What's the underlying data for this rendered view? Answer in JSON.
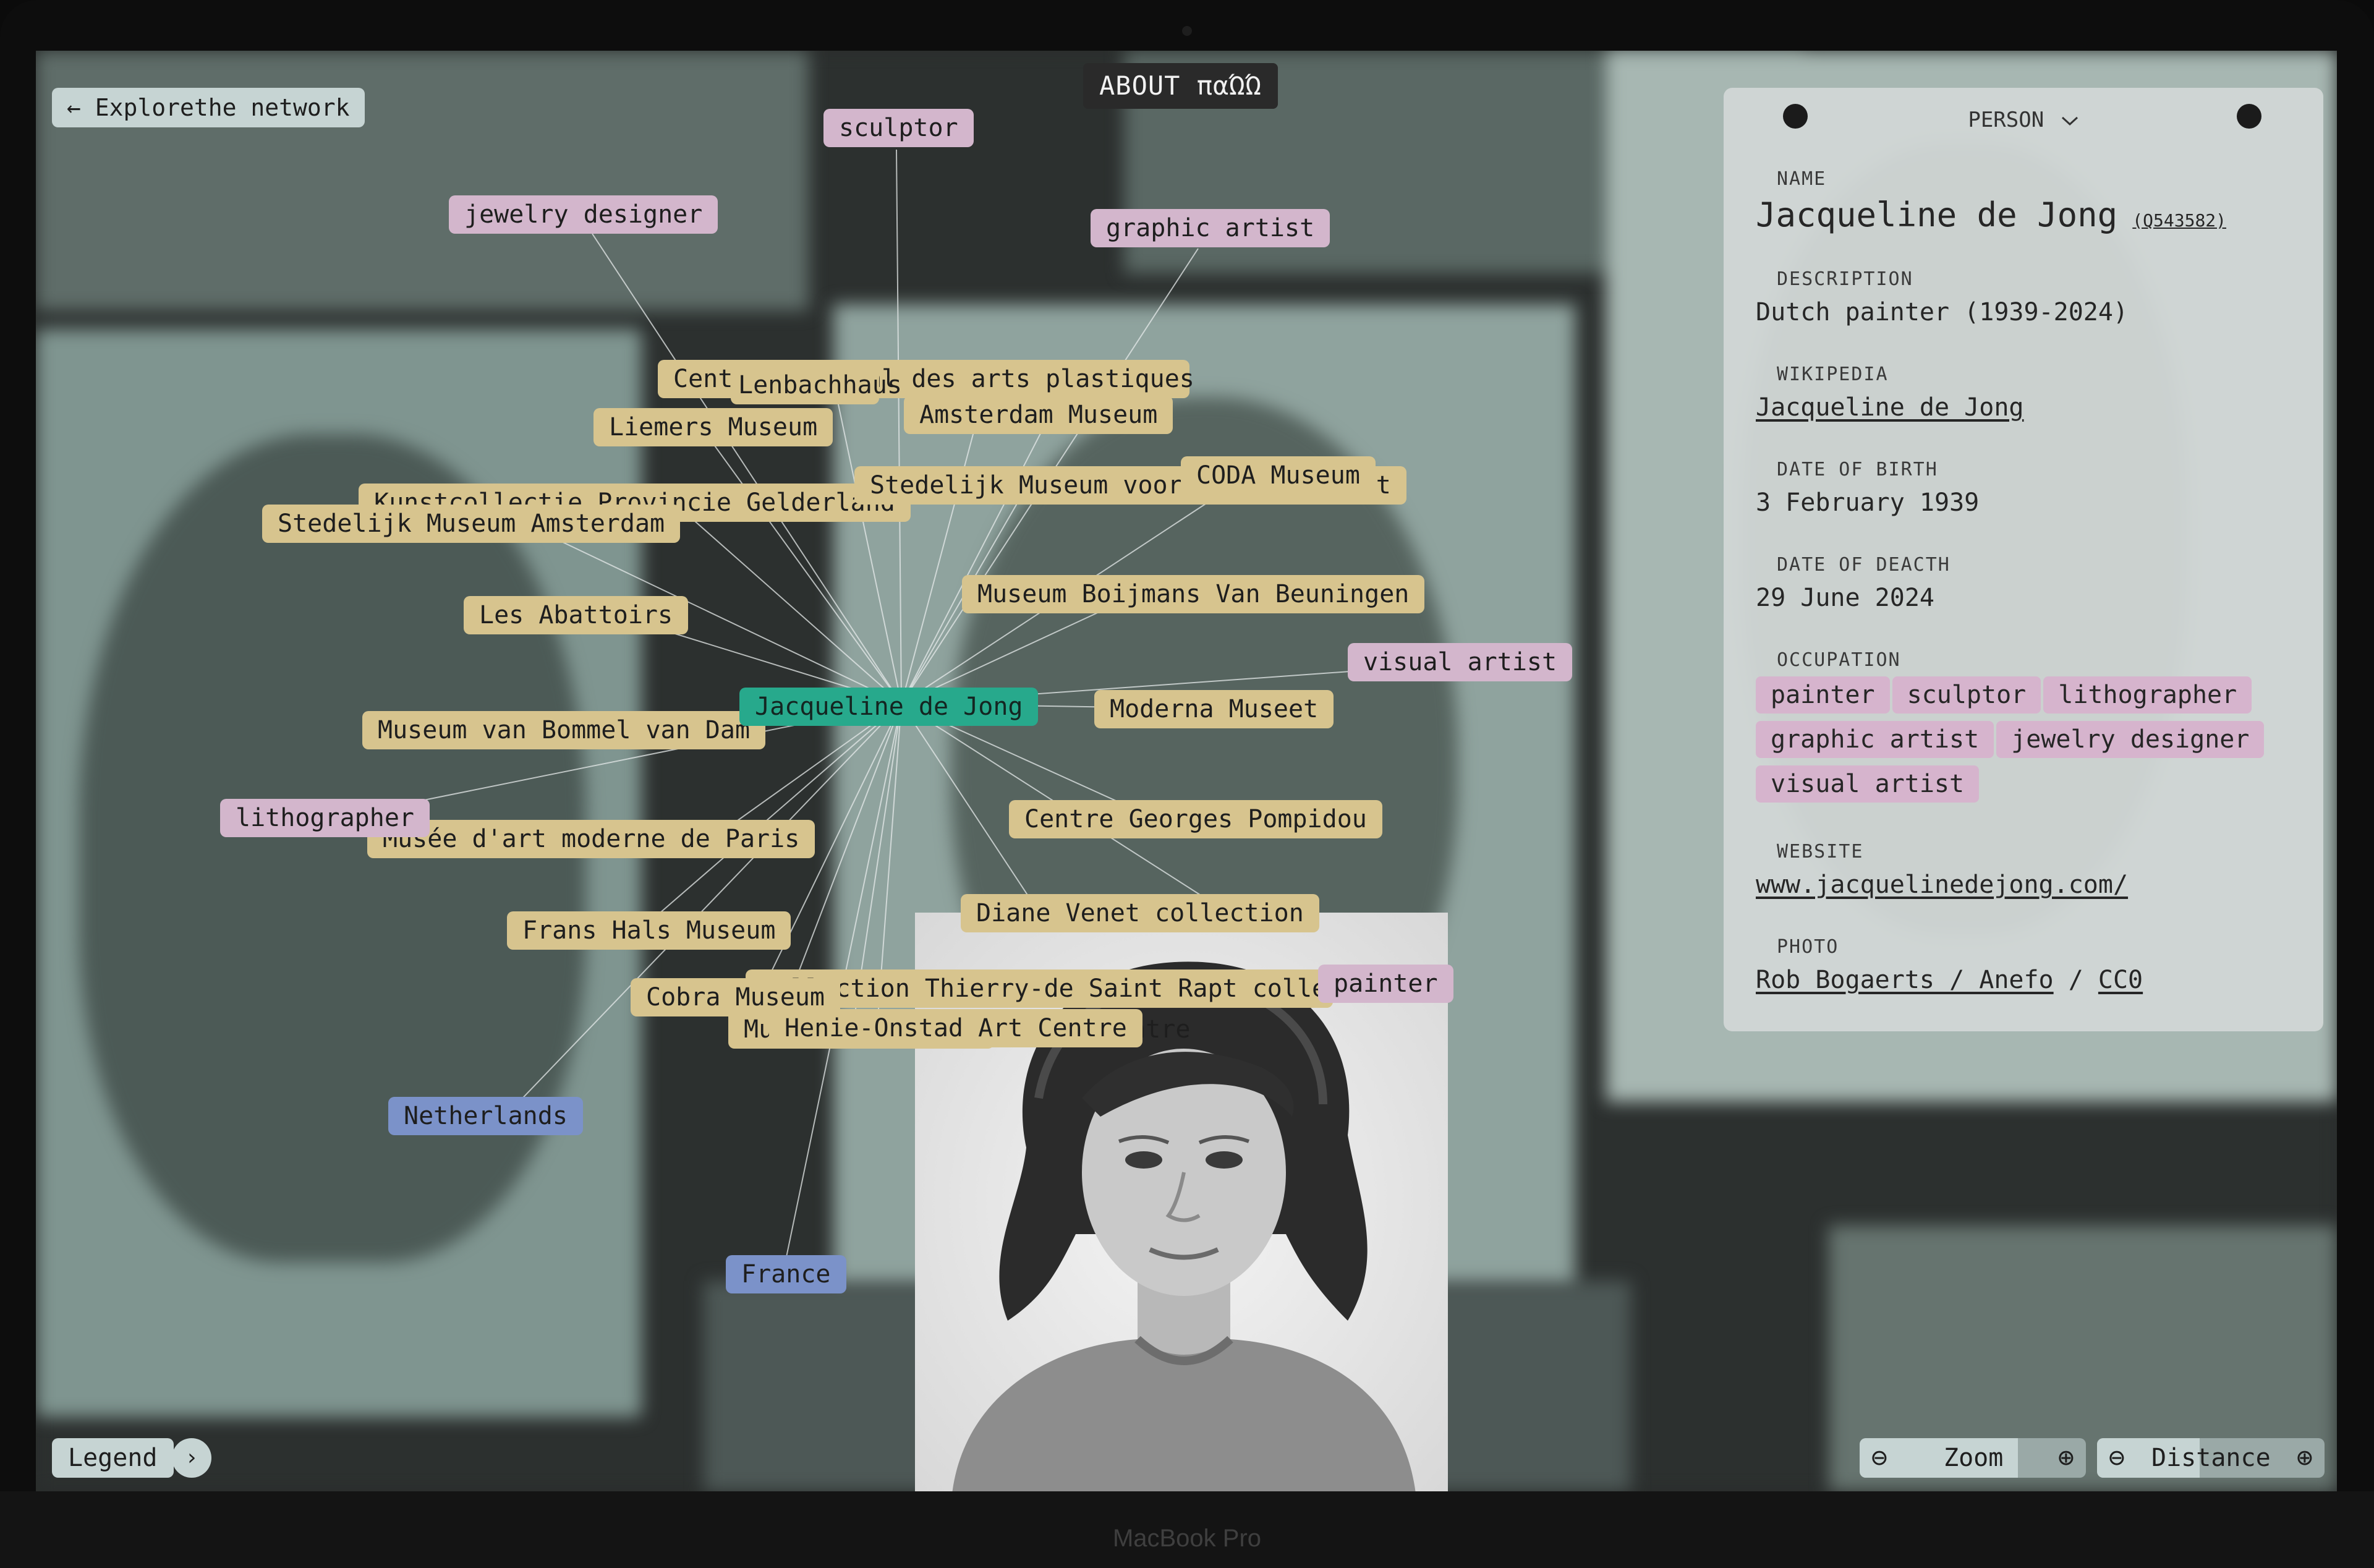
{
  "device": {
    "model_label": "MacBook Pro"
  },
  "header": {
    "back_label": "← Explorethe network",
    "about_label": "ABOUT παΏΏ"
  },
  "graph": {
    "center": "Jacqueline de Jong",
    "organizations": [
      "Centre national des arts plastiques",
      "Lenbachhaus",
      "Amsterdam Museum",
      "Liemers Museum",
      "Stedelijk Museum voor Actuele Kunst",
      "CODA Museum",
      "Kunstcollectie Provincie Gelderland",
      "Stedelijk Museum Amsterdam",
      "Museum Boijmans Van Beuningen",
      "Les Abattoirs",
      "Moderna Museet",
      "Museum van Bommel van Dam",
      "Musée d'art moderne de Paris",
      "Centre Georges Pompidou",
      "Diane Venet collection",
      "Frans Hals Museum",
      "Collection Thierry-de Saint Rapt collection",
      "Cobra Museum",
      "Museum Henie-Onstad Art Centre",
      "Henie-Onstad Art Centre"
    ],
    "occupations": [
      "sculptor",
      "jewelry designer",
      "graphic artist",
      "visual artist",
      "lithographer",
      "painter"
    ],
    "countries": [
      "Netherlands",
      "France"
    ]
  },
  "panel": {
    "type_label": "PERSON",
    "name_label": "NAME",
    "name_value": "Jacqueline de Jong",
    "qid": "(Q543582)",
    "description_label": "DESCRIPTION",
    "description_value": "Dutch painter (1939-2024)",
    "wikipedia_label": "WIKIPEDIA",
    "wikipedia_value": "Jacqueline de Jong",
    "dob_label": "DATE OF BIRTH",
    "dob_value": "3 February 1939",
    "dod_label": "DATE OF DEACTH",
    "dod_value": "29 June 2024",
    "occupation_label": "OCCUPATION",
    "occupations": [
      "painter",
      "sculptor",
      "lithographer",
      "graphic artist",
      "jewelry designer",
      "visual artist"
    ],
    "website_label": "WEBSITE",
    "website_value": "www.jacquelinedejong.com/",
    "photo_label": "PHOTO",
    "photo_author": "Rob Bogaerts / Anefo",
    "photo_sep": " / ",
    "photo_license": "CC0"
  },
  "controls": {
    "legend_label": "Legend",
    "legend_arrow": "›",
    "zoom_label": "Zoom",
    "zoom_level": 0.7,
    "distance_label": "Distance",
    "distance_level": 0.45,
    "minus_symbol": "⊖",
    "plus_symbol": "⊕"
  },
  "colors": {
    "organization": "#d7c48e",
    "occupation": "#d3b6cc",
    "country": "#7b92c9",
    "center": "#27a98c"
  }
}
